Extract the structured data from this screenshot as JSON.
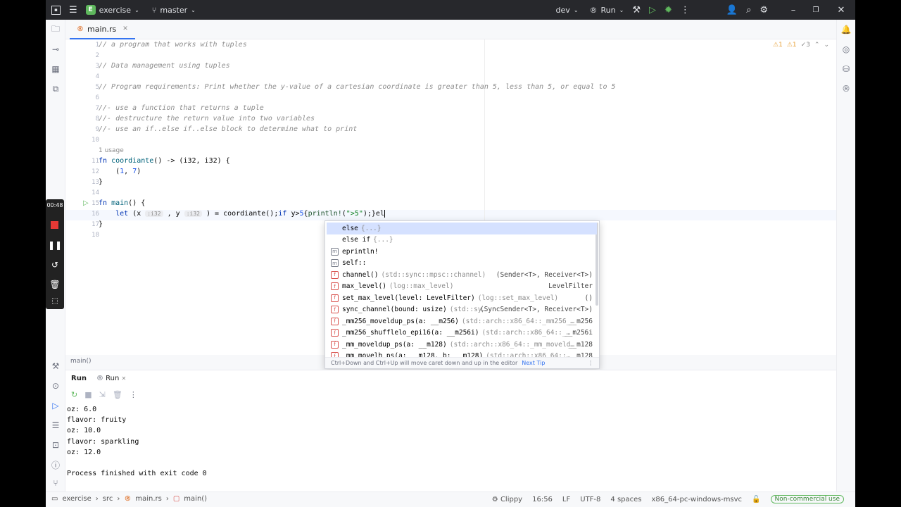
{
  "titlebar": {
    "project_badge": "E",
    "project": "exercise",
    "branch": "master",
    "run_config": "dev",
    "run_label": "Run"
  },
  "tabs": [
    {
      "label": "main.rs"
    }
  ],
  "editor": {
    "inspections": {
      "warnings": "1",
      "weak": "1",
      "typos": "3"
    },
    "usage_hint": "1 usage",
    "line_numbers": [
      "1",
      "2",
      "3",
      "4",
      "5",
      "6",
      "7",
      "8",
      "9",
      "10",
      "11",
      "12",
      "13",
      "14",
      "15",
      "16",
      "17",
      "18"
    ],
    "comments": {
      "l1": "// a program that works with tuples",
      "l3": "// Data management using tuples",
      "l5": "// Program requirements: Print whether the y-value of a cartesian coordinate is greater than 5, less than 5, or equal to 5",
      "l7": "//- use a function that returns a tuple",
      "l8": "//- destructure the return value into two variables",
      "l9": "//- use an if..else if..else block to determine what to print"
    },
    "fn_kw": "fn",
    "fn_name": "coordiante",
    "fn_sig": "() -> (i32, i32) {",
    "tuple_open": "(",
    "tuple_1": "1",
    "tuple_sep": ", ",
    "tuple_7": "7",
    "tuple_close": ")",
    "close_brace": "}",
    "main_name": "main",
    "main_sig": "() {",
    "let_kw": "let",
    "open_paren": "(",
    "var_x": "x",
    "hint_x": ":i32",
    "comma": ",",
    "var_y": "y",
    "hint_y": ":i32",
    "after_pattern": ") = coordiante();",
    "if_kw": "if",
    "cond_y": "y",
    "cond_gt": ">",
    "cond_5": "5",
    "cond_brace": "{",
    "println": "println!",
    "p_open": "(",
    "str_gt5": "\">5\"",
    "p_close": ");}",
    "typed": "el",
    "breadcrumb": "main()"
  },
  "completion": {
    "items": [
      {
        "icon": "",
        "name": "else",
        "tail": "{...}",
        "type": ""
      },
      {
        "icon": "",
        "name": "else if",
        "tail": "{...}",
        "type": ""
      },
      {
        "icon": "m",
        "name": "eprintln!",
        "tail": "",
        "type": ""
      },
      {
        "icon": "m",
        "name": "self::",
        "tail": "",
        "type": ""
      },
      {
        "icon": "f",
        "name": "channel()",
        "tail": "(std::sync::mpsc::channel)",
        "type": "(Sender<T>, Receiver<T>)"
      },
      {
        "icon": "f",
        "name": "max_level()",
        "tail": "(log::max_level)",
        "type": "LevelFilter"
      },
      {
        "icon": "f",
        "name": "set_max_level(level: LevelFilter)",
        "tail": "(log::set_max_level)",
        "type": "()"
      },
      {
        "icon": "f",
        "name": "sync_channel(bound: usize)",
        "tail": "(std::sy…",
        "type": "(SyncSender<T>, Receiver<T>)"
      },
      {
        "icon": "f",
        "name": "_mm256_moveldup_ps(a: __m256)",
        "tail": "(std::arch::x86_64::_mm256_…",
        "type": "__m256"
      },
      {
        "icon": "f",
        "name": "_mm256_shufflelo_epi16(a: __m256i)",
        "tail": "(std::arch::x86_64::_…",
        "type": "__m256i"
      },
      {
        "icon": "f",
        "name": "_mm_moveldup_ps(a: __m128)",
        "tail": "(std::arch::x86_64::_mm_moveld…",
        "type": "__m128"
      },
      {
        "icon": "f",
        "name": "_mm_movelh_ps(a: __m128, b: __m128)",
        "tail": "(std::arch::x86_64::…",
        "type": "__m128"
      }
    ],
    "footer_hint": "Ctrl+Down and Ctrl+Up will move caret down and up in the editor",
    "footer_link": "Next Tip"
  },
  "run_panel": {
    "tabs": [
      "Run",
      "Run"
    ],
    "output": [
      "oz: 6.0",
      "flavor: fruity",
      "oz: 10.0",
      "flavor: sparkling",
      "oz: 12.0",
      "",
      "Process finished with exit code 0"
    ]
  },
  "statusbar": {
    "path": [
      "exercise",
      "src",
      "main.rs",
      "main()"
    ],
    "linter": "Clippy",
    "position": "16:56",
    "line_sep": "LF",
    "encoding": "UTF-8",
    "indent": "4 spaces",
    "target": "x86_64-pc-windows-msvc",
    "license": "Non-commercial use"
  },
  "recorder": {
    "time": "00:48"
  },
  "colors": {
    "accent": "#3574f0",
    "stop": "#e53935",
    "green": "#5fb85d"
  }
}
